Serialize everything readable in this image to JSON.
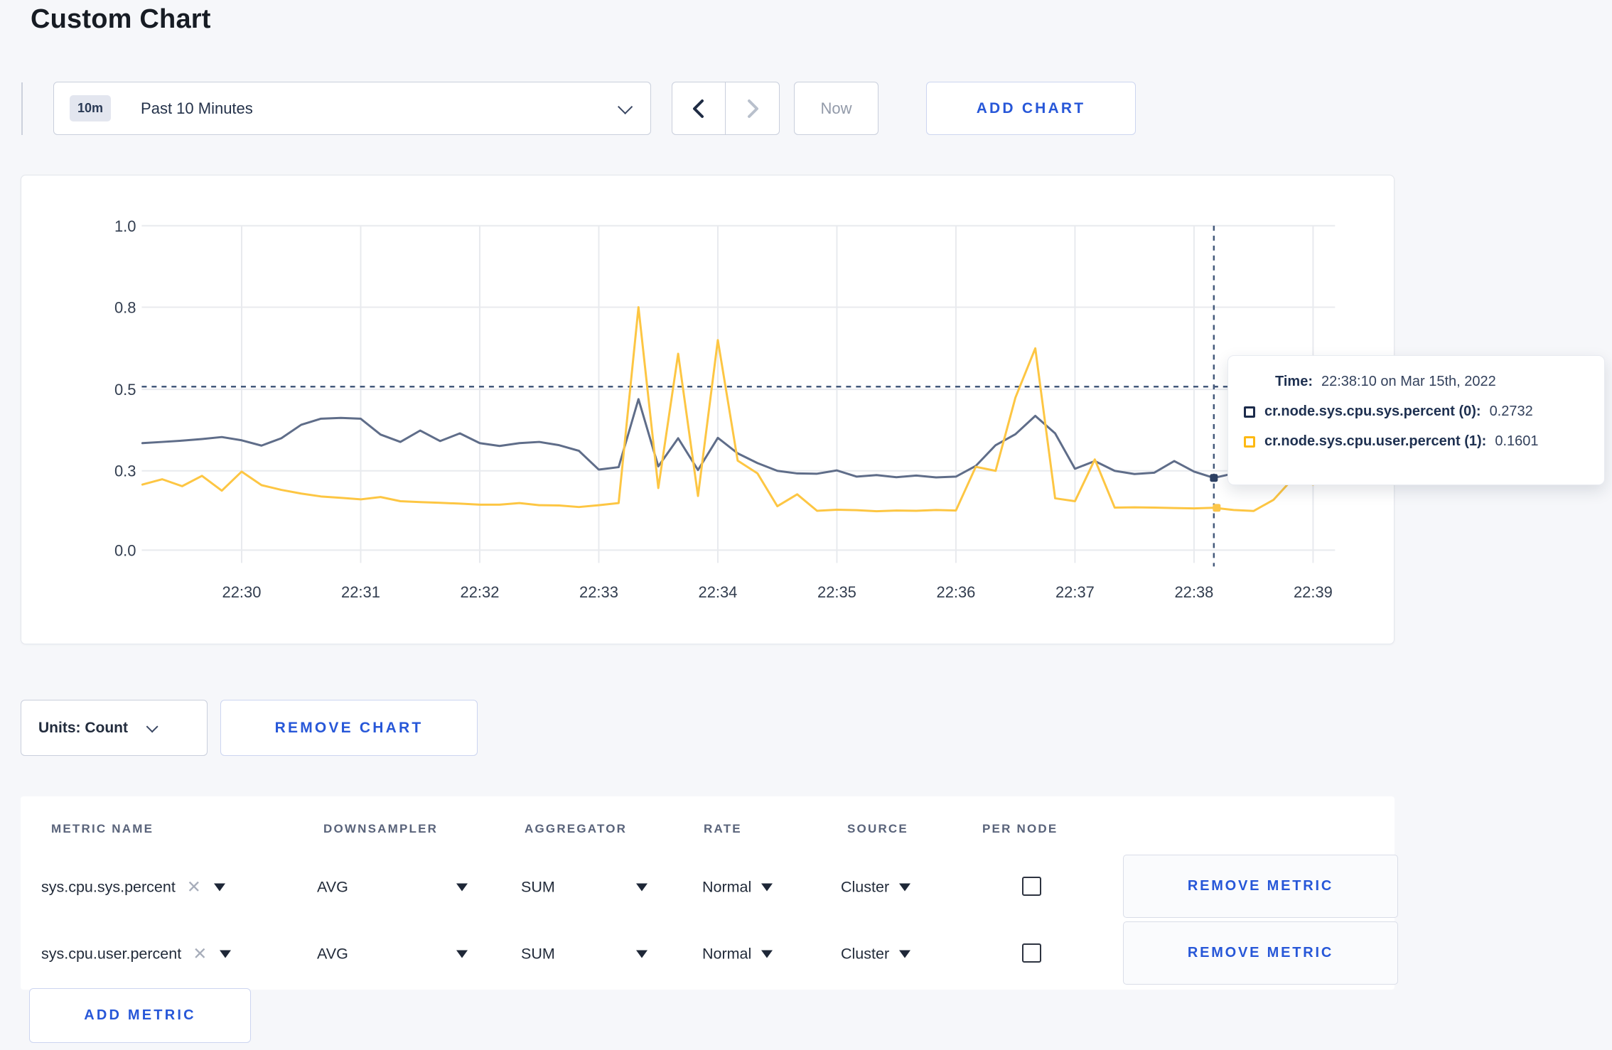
{
  "page": {
    "title": "Custom Chart"
  },
  "toolbar": {
    "time_badge": "10m",
    "time_label": "Past 10 Minutes",
    "now_label": "Now",
    "add_chart_label": "ADD CHART"
  },
  "chart_data": {
    "type": "line",
    "title": "",
    "xlabel": "",
    "ylabel": "",
    "x_ticks": [
      "22:30",
      "22:31",
      "22:32",
      "22:33",
      "22:34",
      "22:35",
      "22:36",
      "22:37",
      "22:38",
      "22:39"
    ],
    "y_ticks": [
      0.0,
      0.3,
      0.5,
      0.8,
      1.0
    ],
    "y_tick_labels": [
      "0.0",
      "0.3",
      "0.5",
      "0.8",
      "1.0"
    ],
    "ylim": [
      0.0,
      1.0
    ],
    "grid": "on",
    "y_axis_note": "tick gridlines equally spaced (nvd3 style), legend shown only in hover tooltip",
    "start_time": "22:29:10",
    "interval_seconds": 10,
    "series": [
      {
        "name": "cr.node.sys.cpu.sys.percent",
        "color": "#5f6d89",
        "values": [
          0.368,
          0.371,
          0.374,
          0.378,
          0.383,
          0.375,
          0.362,
          0.38,
          0.413,
          0.428,
          0.43,
          0.428,
          0.389,
          0.371,
          0.399,
          0.373,
          0.392,
          0.368,
          0.361,
          0.368,
          0.371,
          0.363,
          0.349,
          0.303,
          0.309,
          0.476,
          0.311,
          0.38,
          0.302,
          0.381,
          0.343,
          0.319,
          0.3,
          0.29,
          0.289,
          0.301,
          0.278,
          0.284,
          0.276,
          0.282,
          0.275,
          0.278,
          0.312,
          0.363,
          0.39,
          0.435,
          0.392,
          0.305,
          0.324,
          0.3,
          0.288,
          0.293,
          0.324,
          0.297,
          0.2732,
          0.29,
          0.285,
          0.29,
          0.3,
          0.31
        ]
      },
      {
        "name": "cr.node.sys.cpu.user.percent",
        "color": "#fdc643",
        "values": [
          0.248,
          0.268,
          0.242,
          0.281,
          0.225,
          0.297,
          0.246,
          0.228,
          0.214,
          0.203,
          0.198,
          0.192,
          0.201,
          0.185,
          0.182,
          0.179,
          0.176,
          0.172,
          0.172,
          0.178,
          0.17,
          0.169,
          0.163,
          0.17,
          0.178,
          0.8,
          0.235,
          0.63,
          0.205,
          0.68,
          0.325,
          0.29,
          0.166,
          0.211,
          0.149,
          0.153,
          0.151,
          0.147,
          0.15,
          0.149,
          0.152,
          0.15,
          0.31,
          0.3,
          0.48,
          0.65,
          0.196,
          0.185,
          0.328,
          0.161,
          0.162,
          0.161,
          0.159,
          0.158,
          0.1601,
          0.152,
          0.148,
          0.19,
          0.272,
          0.248
        ]
      }
    ],
    "crosshair": {
      "time": "22:38:10",
      "y_level": 0.51,
      "color": "#44597b"
    },
    "hover_point": {
      "time": "22:38:10",
      "values": [
        0.2732,
        0.1601
      ],
      "dot_colors": [
        "#2e4164",
        "#fcc64a"
      ]
    },
    "colors": {
      "gridline": "#e8eaee",
      "axis_label": "#323d4f"
    }
  },
  "tooltip": {
    "time_label": "Time:",
    "time_value": "22:38:10 on Mar 15th, 2022",
    "rows": [
      {
        "label": "cr.node.sys.cpu.sys.percent (0):",
        "value": "0.2732",
        "color": "#1c2b4b"
      },
      {
        "label": "cr.node.sys.cpu.user.percent (1):",
        "value": "0.1601",
        "color": "#fdb913"
      }
    ]
  },
  "units_bar": {
    "units_label": "Units: Count",
    "remove_chart_label": "REMOVE CHART"
  },
  "metrics_table": {
    "headers": [
      "METRIC NAME",
      "DOWNSAMPLER",
      "AGGREGATOR",
      "RATE",
      "SOURCE",
      "PER NODE"
    ],
    "rows": [
      {
        "metric": "sys.cpu.sys.percent",
        "downsampler": "AVG",
        "aggregator": "SUM",
        "rate": "Normal",
        "source": "Cluster",
        "per_node_checked": false,
        "remove_label": "REMOVE METRIC"
      },
      {
        "metric": "sys.cpu.user.percent",
        "downsampler": "AVG",
        "aggregator": "SUM",
        "rate": "Normal",
        "source": "Cluster",
        "per_node_checked": false,
        "remove_label": "REMOVE METRIC"
      }
    ],
    "add_metric_label": "ADD METRIC"
  }
}
